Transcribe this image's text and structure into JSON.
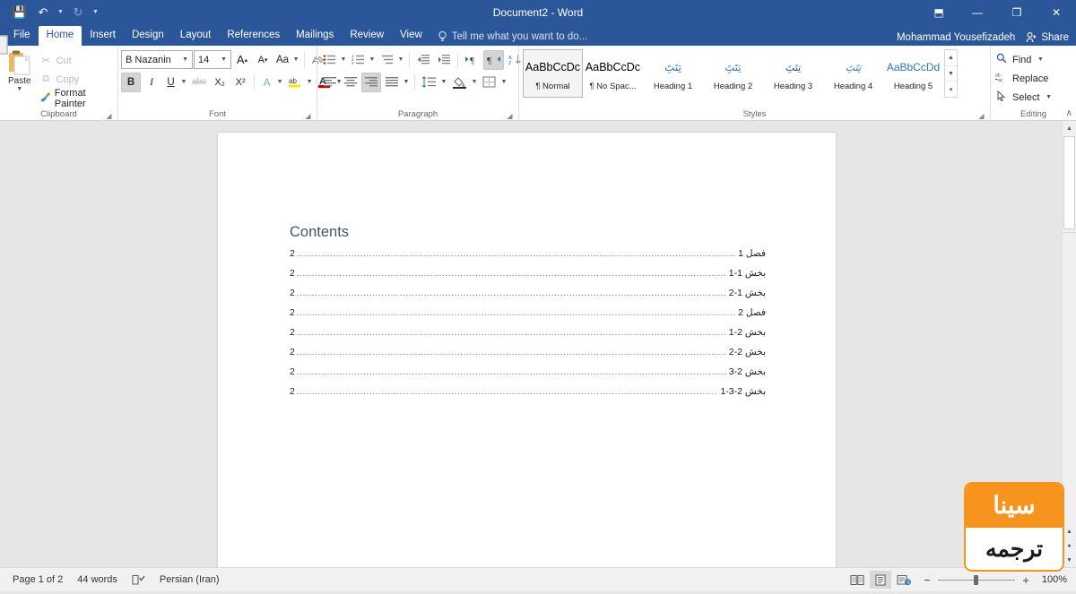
{
  "titlebar": {
    "quick_access": [
      {
        "name": "save",
        "glyph": "💾"
      },
      {
        "name": "undo",
        "glyph": "↶"
      },
      {
        "name": "redo",
        "glyph": "↻"
      }
    ],
    "title": "Document2 - Word",
    "ribbon_display_options": "⬒",
    "minimize": "—",
    "restore": "❐",
    "close": "✕"
  },
  "tabs": [
    {
      "label": "File",
      "active": false
    },
    {
      "label": "Home",
      "active": true
    },
    {
      "label": "Insert",
      "active": false
    },
    {
      "label": "Design",
      "active": false
    },
    {
      "label": "Layout",
      "active": false
    },
    {
      "label": "References",
      "active": false
    },
    {
      "label": "Mailings",
      "active": false
    },
    {
      "label": "Review",
      "active": false
    },
    {
      "label": "View",
      "active": false
    }
  ],
  "tellme": {
    "icon": "💡",
    "placeholder": "Tell me what you want to do..."
  },
  "account": {
    "user_name": "Mohammad Yousefizadeh",
    "share_label": "Share",
    "share_icon": "👤"
  },
  "ribbon": {
    "clipboard": {
      "group_label": "Clipboard",
      "paste_label": "Paste",
      "commands": [
        {
          "label": "Cut",
          "icon": "✂",
          "enabled": false
        },
        {
          "label": "Copy",
          "icon": "⧉",
          "enabled": false
        },
        {
          "label": "Format Painter",
          "icon": "🖌",
          "enabled": true
        }
      ]
    },
    "font": {
      "group_label": "Font",
      "font_name": "B Nazanin",
      "font_size": "14",
      "grow_font": "A",
      "shrink_font": "A",
      "change_case": "Aa",
      "clear_formatting": "✐",
      "bold": "B",
      "italic": "I",
      "underline": "U",
      "strikethrough": "abc",
      "subscript": "X₂",
      "superscript": "X²",
      "text_effects": "A",
      "highlight": "ab",
      "font_color": "A"
    },
    "paragraph": {
      "group_label": "Paragraph",
      "bullets": "≡",
      "numbering": "≡",
      "multilevel": "≡",
      "decrease_indent": "←",
      "increase_indent": "→",
      "ltr": "¶",
      "rtl": "¶",
      "sort": "↓",
      "show_marks": "¶",
      "align_left": "≡",
      "align_center": "≡",
      "align_right": "≡",
      "justify": "≡",
      "line_spacing": "↕",
      "shading": "■",
      "borders": "⊞"
    },
    "styles": {
      "group_label": "Styles",
      "items": [
        {
          "preview": "AaBbCcDc",
          "name": "¶ Normal",
          "selected": true,
          "cls": ""
        },
        {
          "preview": "AaBbCcDc",
          "name": "¶ No Spac...",
          "selected": false,
          "cls": ""
        },
        {
          "preview": "تِتَتَِ",
          "name": "Heading 1",
          "selected": false,
          "cls": "h1"
        },
        {
          "preview": "تِتَتَِ",
          "name": "Heading 2",
          "selected": false,
          "cls": "h2"
        },
        {
          "preview": "تِتَتَِ",
          "name": "Heading 3",
          "selected": false,
          "cls": "h3"
        },
        {
          "preview": "تِتَتَِ",
          "name": "Heading 4",
          "selected": false,
          "cls": "h4"
        },
        {
          "preview": "AaBbCcDd",
          "name": "Heading 5",
          "selected": false,
          "cls": "h5"
        }
      ],
      "scroll_up": "▲",
      "scroll_down": "▼",
      "more": "▾"
    },
    "editing": {
      "group_label": "Editing",
      "commands": [
        {
          "label": "Find",
          "icon": "🔍",
          "has_caret": true
        },
        {
          "label": "Replace",
          "icon": "ab",
          "has_caret": false
        },
        {
          "label": "Select",
          "icon": "▷",
          "has_caret": true
        }
      ]
    },
    "collapse_icon": "∧"
  },
  "document": {
    "toc_title": "Contents",
    "entries": [
      {
        "label": "فصل 1",
        "page": "2"
      },
      {
        "label": "بخش 1-1",
        "page": "2"
      },
      {
        "label": "بخش 1-2",
        "page": "2"
      },
      {
        "label": "فصل 2",
        "page": "2"
      },
      {
        "label": "بخش 2-1",
        "page": "2"
      },
      {
        "label": "بخش 2-2",
        "page": "2"
      },
      {
        "label": "بخش 2-3",
        "page": "2"
      },
      {
        "label": "بخش 2-3-1",
        "page": "2"
      }
    ],
    "leader": "................................................................................................................................................................................................................................................"
  },
  "statusbar": {
    "page_info": "Page 1 of 2",
    "word_count": "44 words",
    "proofing_icon": "📖",
    "language": "Persian (Iran)",
    "views": [
      {
        "name": "read-mode",
        "icon": "📖",
        "active": false
      },
      {
        "name": "print-layout",
        "icon": "▤",
        "active": true
      },
      {
        "name": "web-layout",
        "icon": "☷",
        "active": false
      }
    ],
    "zoom_out": "−",
    "zoom_in": "+",
    "zoom_level": "100%"
  },
  "watermark": {
    "top_text": "سینا",
    "bottom_text": "ترجمه",
    "accent_color": "#f7941d"
  }
}
